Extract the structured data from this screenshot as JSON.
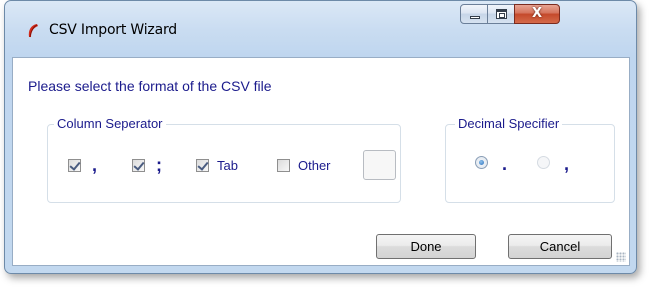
{
  "window": {
    "title": "CSV Import Wizard",
    "app_icon": "red-feather-icon",
    "controls": {
      "minimize": "minimize-icon",
      "maximize": "maximize-icon",
      "close": "close-icon",
      "close_glyph": "X"
    }
  },
  "prompt": "Please select the format of the CSV file",
  "column_separator": {
    "legend": "Column Seperator",
    "options": [
      {
        "symbol": ",",
        "checked": true
      },
      {
        "symbol": ";",
        "checked": true
      },
      {
        "label": "Tab",
        "checked": true
      },
      {
        "label": "Other",
        "checked": false
      }
    ],
    "other_value": ""
  },
  "decimal_specifier": {
    "legend": "Decimal Specifier",
    "options": [
      {
        "symbol": ".",
        "selected": true
      },
      {
        "symbol": ",",
        "selected": false,
        "disabled": true
      }
    ]
  },
  "buttons": {
    "done": "Done",
    "cancel": "Cancel"
  },
  "colors": {
    "label_text": "#1b1b8c",
    "title_bar": "#c9dcf1",
    "close_button": "#c4492b"
  }
}
